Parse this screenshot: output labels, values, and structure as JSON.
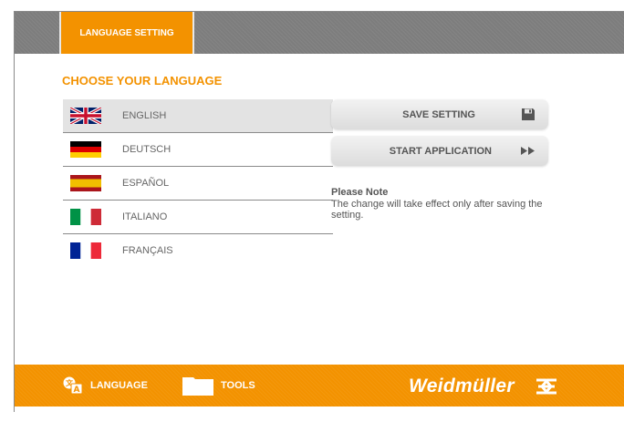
{
  "header": {
    "tab_label": "LANGUAGE SETTING"
  },
  "main": {
    "heading": "CHOOSE YOUR LANGUAGE",
    "languages": [
      {
        "label": "ENGLISH",
        "flag": "uk-flag-icon",
        "selected": true
      },
      {
        "label": "DEUTSCH",
        "flag": "germany-flag-icon",
        "selected": false
      },
      {
        "label": "ESPAÑOL",
        "flag": "spain-flag-icon",
        "selected": false
      },
      {
        "label": "ITALIANO",
        "flag": "italy-flag-icon",
        "selected": false
      },
      {
        "label": "FRANÇAIS",
        "flag": "france-flag-icon",
        "selected": false
      }
    ],
    "buttons": {
      "save_label": "SAVE SETTING",
      "save_icon": "floppy-disk-icon",
      "start_label": "START APPLICATION",
      "start_icon": "fast-forward-icon"
    },
    "note": {
      "title": "Please Note",
      "text": "The change will take effect only after saving the setting."
    }
  },
  "footer": {
    "language_label": "LANGUAGE",
    "language_icon": "translate-icon",
    "tools_label": "TOOLS",
    "tools_icon": "folder-icon",
    "brand": "Weidmüller",
    "brand_icon": "weidmuller-logo-icon"
  },
  "colors": {
    "accent": "#f39200",
    "header_gray": "#7d7d7d",
    "selected_row": "#e3e3e3"
  }
}
